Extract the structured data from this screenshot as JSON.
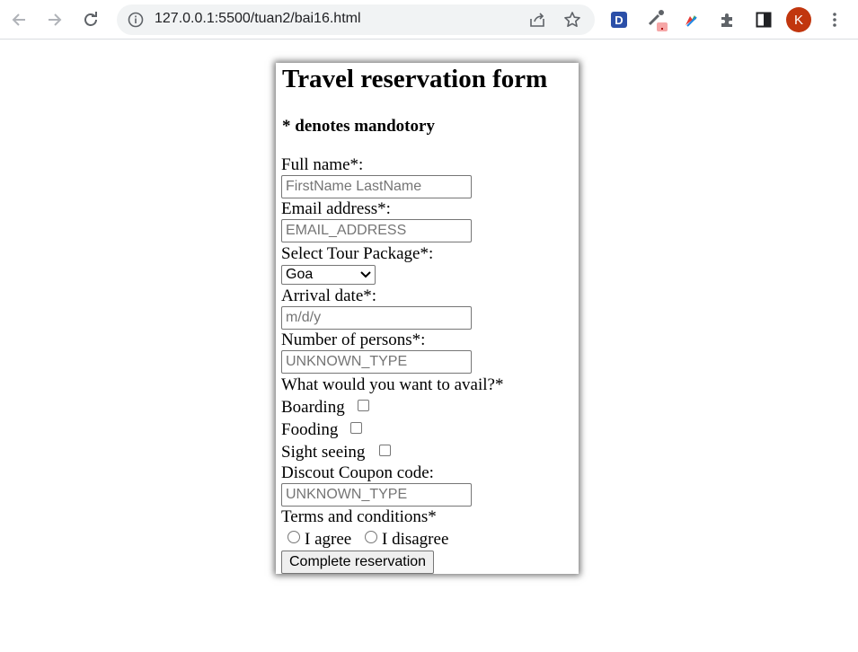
{
  "browser": {
    "url": "127.0.0.1:5500/tuan2/bai16.html",
    "avatar_letter": "K",
    "extension_d_label": "D",
    "icons": [
      "back-icon",
      "forward-icon",
      "reload-icon",
      "info-icon",
      "share-icon",
      "star-icon",
      "extension-d-icon",
      "eyedropper-icon",
      "colorful-extension-icon",
      "puzzle-icon",
      "side-panel-icon",
      "kebab-menu-icon"
    ]
  },
  "form": {
    "title": "Travel reservation form",
    "note": "* denotes mandotory",
    "full_name": {
      "label": "Full name*:",
      "placeholder": "FirstName LastName"
    },
    "email": {
      "label": "Email address*:",
      "placeholder": "EMAIL_ADDRESS"
    },
    "tour_package": {
      "label": "Select Tour Package*:",
      "selected": "Goa"
    },
    "arrival_date": {
      "label": "Arrival date*:",
      "placeholder": "m/d/y"
    },
    "persons": {
      "label": "Number of persons*:",
      "placeholder": "UNKNOWN_TYPE"
    },
    "avail": {
      "question": "What would you want to avail?*",
      "options": [
        "Boarding",
        "Fooding",
        "Sight seeing"
      ]
    },
    "coupon": {
      "label": "Discout Coupon code:",
      "placeholder": "UNKNOWN_TYPE"
    },
    "terms": {
      "label": "Terms and conditions*",
      "agree": "I agree",
      "disagree": "I disagree"
    },
    "submit_label": "Complete reservation"
  }
}
